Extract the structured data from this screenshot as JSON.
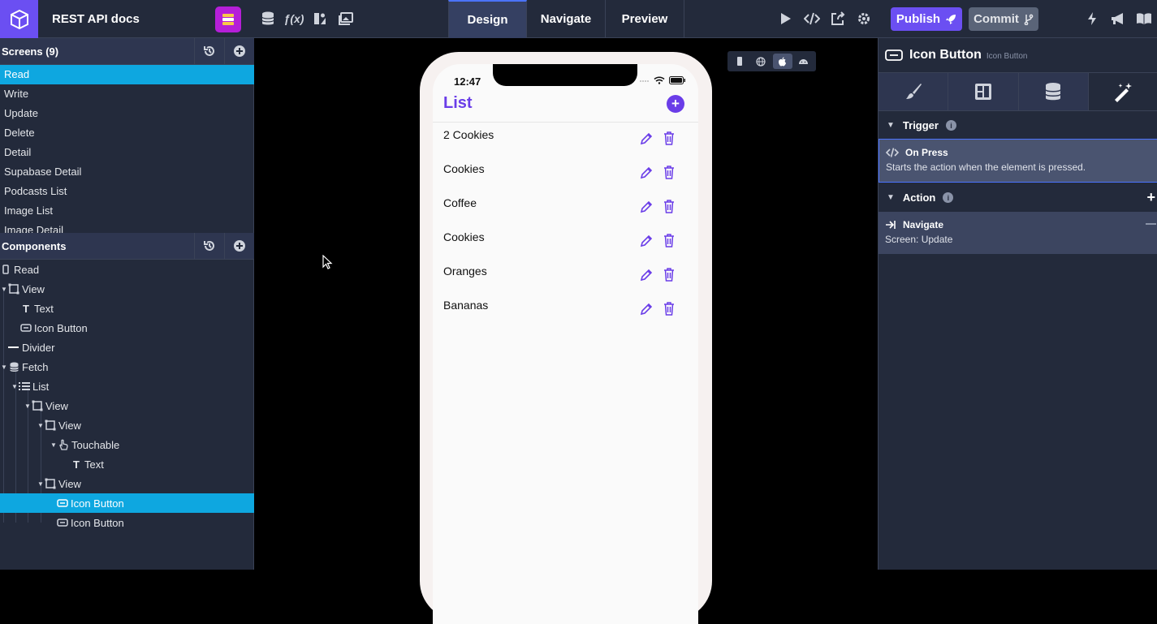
{
  "app": {
    "project_title": "REST API docs"
  },
  "toolbar": {
    "tabs": [
      {
        "label": "Design",
        "active": true
      },
      {
        "label": "Navigate",
        "active": false
      },
      {
        "label": "Preview",
        "active": false
      }
    ],
    "publish_label": "Publish",
    "commit_label": "Commit"
  },
  "screens": {
    "title": "Screens (9)",
    "items": [
      {
        "label": "Read",
        "selected": true
      },
      {
        "label": "Write"
      },
      {
        "label": "Update"
      },
      {
        "label": "Delete"
      },
      {
        "label": "Detail"
      },
      {
        "label": "Supabase Detail"
      },
      {
        "label": "Podcasts List"
      },
      {
        "label": "Image List"
      },
      {
        "label": "Image Detail"
      }
    ]
  },
  "components": {
    "title": "Components",
    "tree": [
      {
        "label": "Read",
        "icon": "screen-icon",
        "depth": 0
      },
      {
        "label": "View",
        "icon": "view-icon",
        "depth": 0,
        "caret": true
      },
      {
        "label": "Text",
        "icon": "text-icon",
        "depth": 1
      },
      {
        "label": "Icon Button",
        "icon": "icon-button-icon",
        "depth": 1
      },
      {
        "label": "Divider",
        "icon": "divider-icon",
        "depth": 0
      },
      {
        "label": "Fetch",
        "icon": "database-icon",
        "depth": 0,
        "caret": true
      },
      {
        "label": "List",
        "icon": "list-icon",
        "depth": 1,
        "caret": true
      },
      {
        "label": "View",
        "icon": "view-icon",
        "depth": 2,
        "caret": true
      },
      {
        "label": "View",
        "icon": "view-icon",
        "depth": 3,
        "caret": true
      },
      {
        "label": "Touchable",
        "icon": "touchable-icon",
        "depth": 4,
        "caret": true
      },
      {
        "label": "Text",
        "icon": "text-icon",
        "depth": 5
      },
      {
        "label": "View",
        "icon": "view-icon",
        "depth": 3,
        "caret": true
      },
      {
        "label": "Icon Button",
        "icon": "icon-button-icon",
        "depth": 4,
        "selected": true
      },
      {
        "label": "Icon Button",
        "icon": "icon-button-icon",
        "depth": 4
      }
    ]
  },
  "phone": {
    "time": "12:47",
    "list_title": "List",
    "items": [
      "2 Cookies",
      "Cookies",
      "Coffee",
      "Cookies",
      "Oranges",
      "Bananas"
    ]
  },
  "inspector": {
    "title": "Icon Button",
    "subtitle": "Icon Button",
    "trigger_section": "Trigger",
    "trigger_title": "On Press",
    "trigger_desc": "Starts the action when the element is pressed.",
    "action_section": "Action",
    "action_title": "Navigate",
    "action_desc": "Screen: Update"
  },
  "colors": {
    "accent": "#6b4ff2",
    "selection": "#0ea7e0",
    "panel": "#232a3b",
    "list_purple": "#6a3de8"
  }
}
